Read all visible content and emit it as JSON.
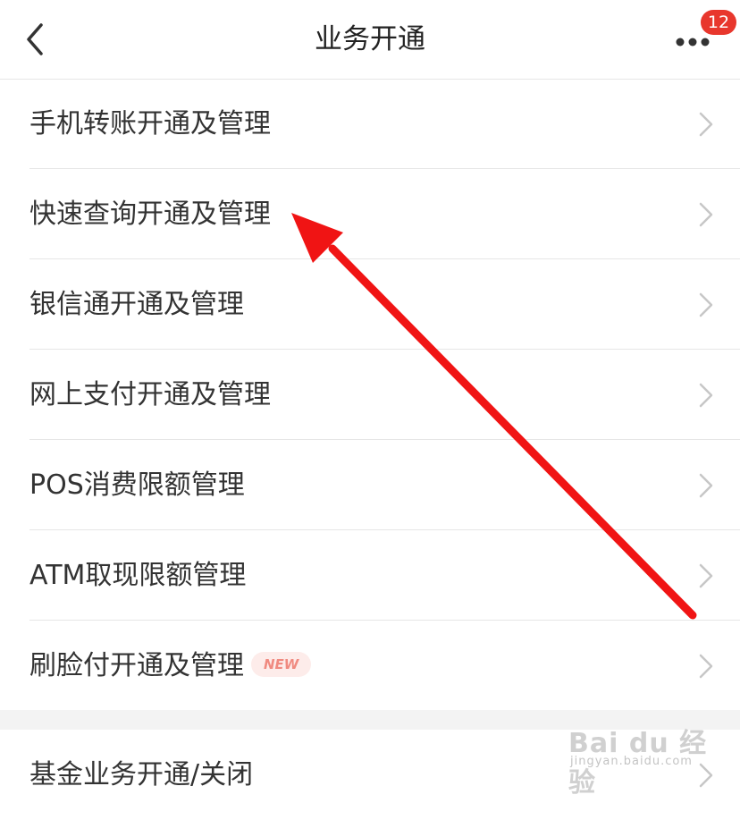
{
  "navbar": {
    "title": "业务开通",
    "badge_count": "12"
  },
  "menu": [
    {
      "label": "手机转账开通及管理"
    },
    {
      "label": "快速查询开通及管理"
    },
    {
      "label": "银信通开通及管理"
    },
    {
      "label": "网上支付开通及管理"
    },
    {
      "label": "POS消费限额管理"
    },
    {
      "label": "ATM取现限额管理"
    },
    {
      "label": "刷脸付开通及管理",
      "tag": "NEW"
    }
  ],
  "menu2": [
    {
      "label": "基金业务开通/关闭"
    }
  ],
  "annotation": {
    "arrow_color": "#f01414"
  },
  "watermark": {
    "brand": "Bai du 经验",
    "url": "jingyan.baidu.com"
  },
  "colors": {
    "badge": "#e8372d",
    "divider": "#e6e6e6",
    "section_gap": "#f3f3f3"
  },
  "icons": {
    "back": "chevron-left-icon",
    "more": "more-dots-icon",
    "row_arrow": "chevron-right-icon"
  }
}
